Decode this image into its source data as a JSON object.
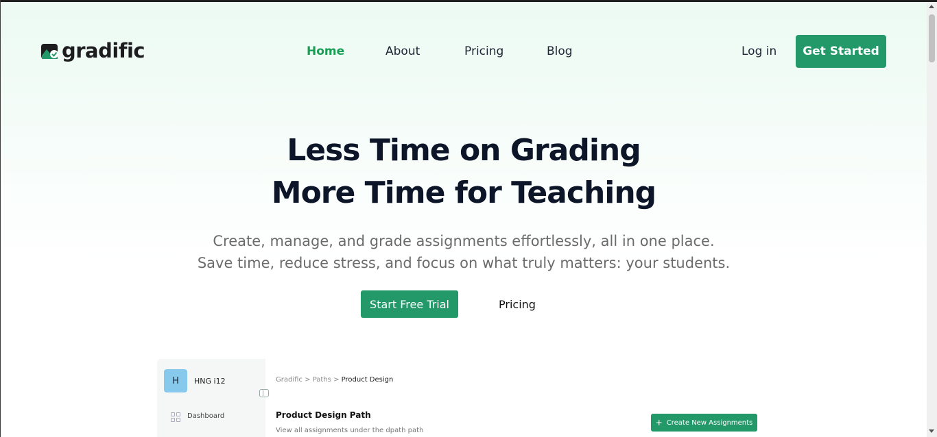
{
  "brand": {
    "name_prefix": "gradific",
    "accent": "#23996a",
    "active_nav": "#1a9d55"
  },
  "nav": {
    "items": [
      {
        "label": "Home",
        "active": true
      },
      {
        "label": "About",
        "active": false
      },
      {
        "label": "Pricing",
        "active": false
      },
      {
        "label": "Blog",
        "active": false
      }
    ],
    "login": "Log in",
    "cta": "Get Started"
  },
  "hero": {
    "title_line1": "Less Time on Grading",
    "title_line2": "More Time for Teaching",
    "subtitle_line1": "Create, manage, and grade assignments effortlessly, all in one place.",
    "subtitle_line2": "Save time, reduce stress, and focus on what truly matters: your students.",
    "primary_button": "Start Free Trial",
    "secondary_button": "Pricing"
  },
  "preview": {
    "avatar_letter": "H",
    "org_name": "HNG i12",
    "sidebar_item": "Dashboard",
    "breadcrumb": {
      "root": "Gradific",
      "sep": ">",
      "middle": "Paths",
      "current": "Product Design"
    },
    "page_title": "Product Design Path",
    "page_desc": "View all assignments under the dpath path",
    "create_button": "Create New Assignments"
  }
}
